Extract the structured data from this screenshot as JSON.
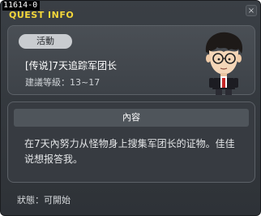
{
  "window": {
    "quest_id": "11614-0",
    "title": "QUEST INFO",
    "close_glyph": "×"
  },
  "quest": {
    "category": "活動",
    "name": "[传说]7天追踪军团长",
    "level": "建議等級：13~17"
  },
  "content": {
    "header": "內容",
    "text": "在7天內努力从怪物身上搜集军团长的证物。佳佳说想报答我。"
  },
  "status": {
    "text": "狀態：可開始"
  },
  "icons": {
    "npc": "npc-portrait-icon",
    "close": "close-icon"
  }
}
